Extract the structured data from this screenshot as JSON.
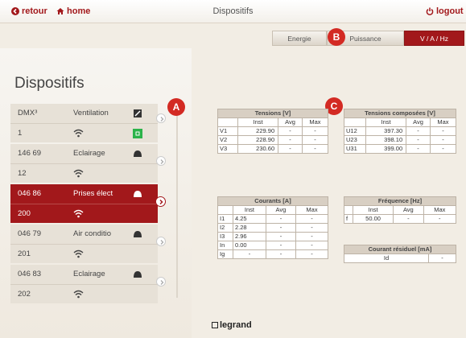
{
  "header": {
    "back_label": "retour",
    "home_label": "home",
    "title": "Dispositifs",
    "logout_label": "logout"
  },
  "tabs": [
    {
      "label": "Energie",
      "active": false
    },
    {
      "label": "Puissance",
      "active": false
    },
    {
      "label": "V / A / Hz",
      "active": true
    }
  ],
  "page_title": "Dispositifs",
  "devices": [
    {
      "id": "DMX³",
      "name": "Ventilation",
      "number": "1",
      "icon": "panel-icon",
      "status_icon": "green-on-icon",
      "selected": false
    },
    {
      "id": "146 69",
      "name": "Eclairage",
      "number": "12",
      "icon": "dome-icon",
      "selected": false
    },
    {
      "id": "046 86",
      "name": "Prises élect",
      "number": "200",
      "icon": "dome-icon",
      "selected": true
    },
    {
      "id": "046 79",
      "name": "Air conditio",
      "number": "201",
      "icon": "dome-icon",
      "selected": false
    },
    {
      "id": "046 83",
      "name": "Eclairage",
      "number": "202",
      "icon": "dome-icon",
      "selected": false
    }
  ],
  "annotations": [
    "A",
    "B",
    "C"
  ],
  "tensions": {
    "title": "Tensions [V]",
    "cols": [
      "Inst",
      "Avg",
      "Max"
    ],
    "rows": [
      {
        "label": "V1",
        "inst": "229.90",
        "avg": "-",
        "max": "-"
      },
      {
        "label": "V2",
        "inst": "228.90",
        "avg": "-",
        "max": "-"
      },
      {
        "label": "V3",
        "inst": "230.60",
        "avg": "-",
        "max": "-"
      }
    ]
  },
  "tensions_composees": {
    "title": "Tensions composées [V]",
    "cols": [
      "Inst",
      "Avg",
      "Max"
    ],
    "rows": [
      {
        "label": "U12",
        "inst": "397.30",
        "avg": "-",
        "max": "-"
      },
      {
        "label": "U23",
        "inst": "398.10",
        "avg": "-",
        "max": "-"
      },
      {
        "label": "U31",
        "inst": "399.00",
        "avg": "-",
        "max": "-"
      }
    ]
  },
  "courants": {
    "title": "Courants [A]",
    "cols": [
      "Inst",
      "Avg",
      "Max"
    ],
    "rows": [
      {
        "label": "I1",
        "inst": "4.25",
        "avg": "-",
        "max": "-"
      },
      {
        "label": "I2",
        "inst": "2.28",
        "avg": "-",
        "max": "-"
      },
      {
        "label": "I3",
        "inst": "2.96",
        "avg": "-",
        "max": "-"
      },
      {
        "label": "In",
        "inst": "0.00",
        "avg": "-",
        "max": "-"
      },
      {
        "label": "Ig",
        "inst": "-",
        "avg": "-",
        "max": "-"
      }
    ]
  },
  "frequence": {
    "title": "Fréquence [Hz]",
    "cols": [
      "Inst",
      "Avg",
      "Max"
    ],
    "rows": [
      {
        "label": "f",
        "inst": "50.00",
        "avg": "-",
        "max": "-"
      }
    ]
  },
  "courant_residuel": {
    "title": "Courant résiduel [mA]",
    "label": "Id",
    "value": "-"
  },
  "brand": "legrand",
  "colors": {
    "accent": "#a2181b",
    "badge": "#d32a23",
    "status_on": "#2bb34a"
  }
}
